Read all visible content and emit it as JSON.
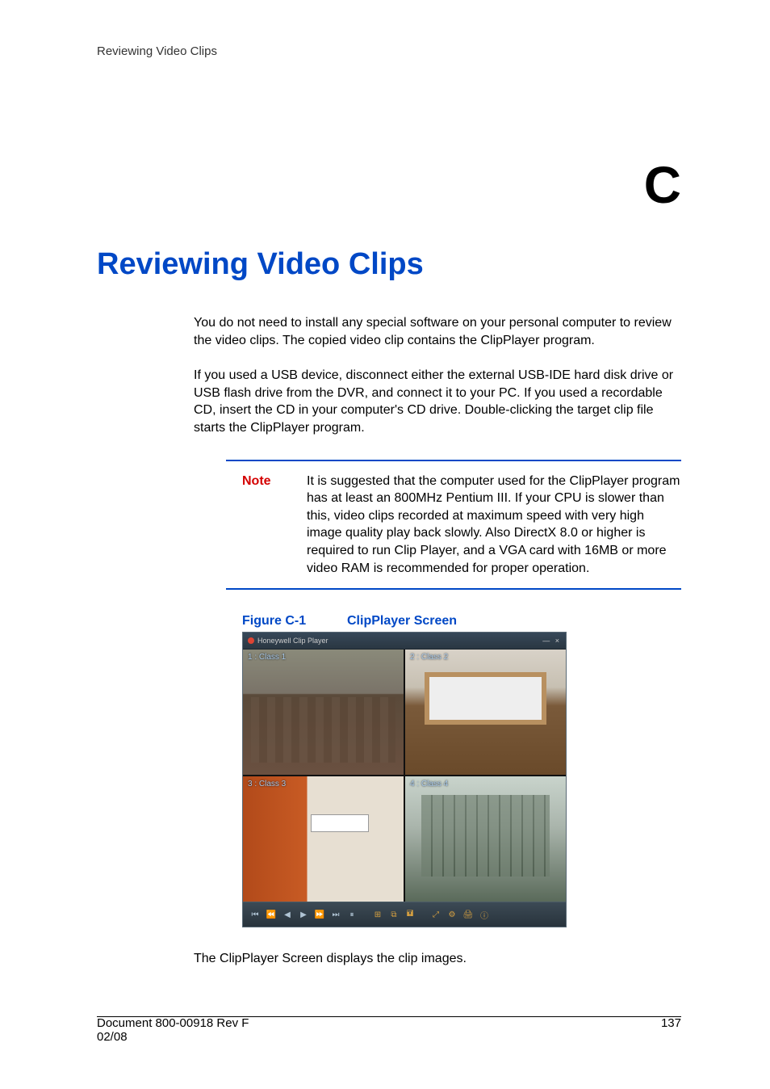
{
  "running_head": "Reviewing Video Clips",
  "appendix_letter": "C",
  "chapter_title": "Reviewing Video Clips",
  "para1": "You do not need to install any special software on your personal computer to review the video clips. The copied video clip contains the ClipPlayer program.",
  "para2": "If you used a USB device, disconnect either the external USB-IDE hard disk drive or USB flash drive from the DVR, and connect it to your PC. If you used a recordable CD, insert the CD in your computer's CD drive. Double-clicking the target clip file starts the ClipPlayer program.",
  "note": {
    "label": "Note",
    "text": "It is suggested that the computer used for the ClipPlayer program has at least an 800MHz Pentium III. If your CPU is slower than this, video clips recorded at maximum speed with very high image quality play back slowly. Also DirectX 8.0 or higher is required to run Clip Player, and a VGA card with 16MB or more video RAM is recommended for proper operation."
  },
  "figure": {
    "label": "Figure C-1",
    "title": "ClipPlayer Screen",
    "titlebar_left": "Honeywell Clip Player",
    "titlebar_right": "— ×",
    "panes": [
      "1 : Class 1",
      "2 : Class 2",
      "3 : Class 3",
      "4 : Class 4"
    ],
    "controls": [
      "⏮",
      "⏪",
      "◀",
      "▶",
      "⏩",
      "⏭",
      "⏸",
      "",
      "⊞",
      "⧉",
      "🖬",
      "",
      "⤢",
      "⚙",
      "🖨",
      "ⓘ"
    ]
  },
  "caption_after_figure": "The ClipPlayer Screen displays the clip images.",
  "footer": {
    "doc": "Document 800-00918 Rev F",
    "date": "02/08",
    "page": "137"
  }
}
